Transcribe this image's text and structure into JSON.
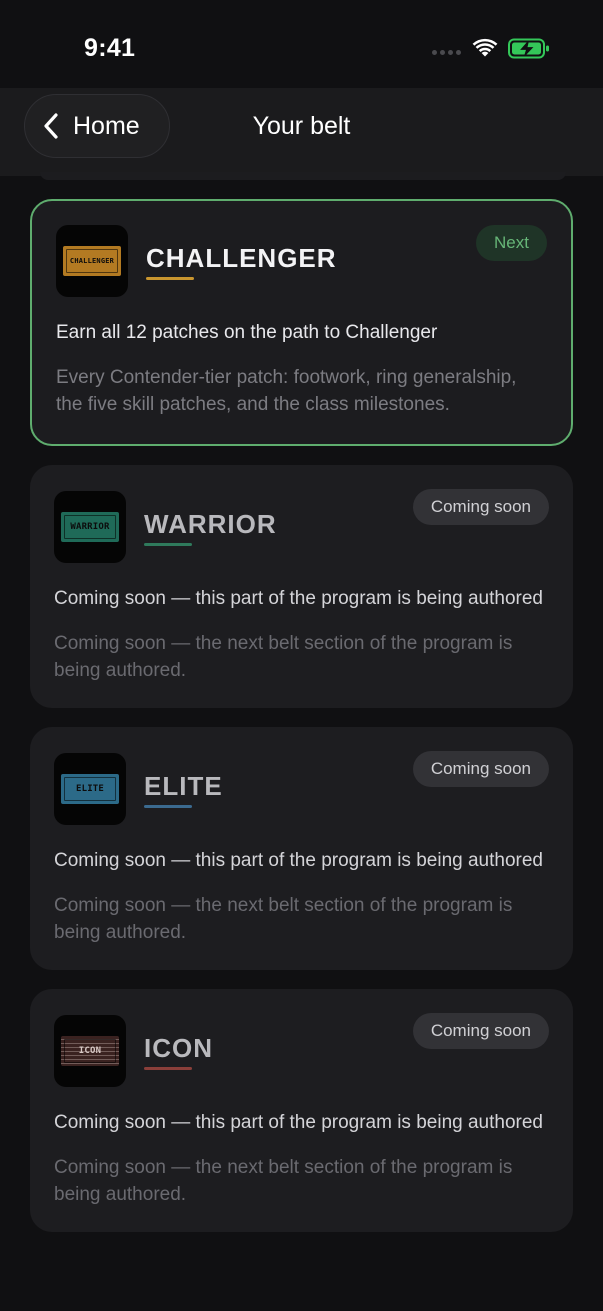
{
  "status_bar": {
    "time": "9:41"
  },
  "header": {
    "back_label": "Home",
    "title": "Your belt"
  },
  "belts": [
    {
      "name": "CHALLENGER",
      "patch_text": "CHALLENGER",
      "badge": "Next",
      "description": "Earn all 12 patches on the path to Challenger",
      "detail": "Every Contender-tier patch: footwork, ring generalship, the five skill patches, and the class milestones.",
      "accent": "#c9962f",
      "patch_fill": "#b37a22"
    },
    {
      "name": "WARRIOR",
      "patch_text": "WARRIOR",
      "badge": "Coming soon",
      "description": "Coming soon — this part of the program is being authored",
      "detail": "Coming soon — the next belt section of the program is being authored.",
      "accent": "#2f7a5c",
      "patch_fill": "#1f6a58"
    },
    {
      "name": "ELITE",
      "patch_text": "ELITE",
      "badge": "Coming soon",
      "description": "Coming soon — this part of the program is being authored",
      "detail": "Coming soon — the next belt section of the program is being authored.",
      "accent": "#3b6a8f",
      "patch_fill": "#2c6a88"
    },
    {
      "name": "ICON",
      "patch_text": "ICON",
      "badge": "Coming soon",
      "description": "Coming soon — this part of the program is being authored",
      "detail": "Coming soon — the next belt section of the program is being authored.",
      "accent": "#8a3f3a",
      "patch_fill": "#3a2220"
    }
  ],
  "colors": {
    "background": "#101012",
    "card": "#1d1d20",
    "next_border": "#5fad6e",
    "next_badge_text": "#66b577",
    "battery": "#34c759"
  },
  "icons": {
    "back": "chevron-left-icon",
    "wifi": "wifi-icon",
    "battery": "battery-charging-icon",
    "signal": "cellular-signal-icon"
  }
}
